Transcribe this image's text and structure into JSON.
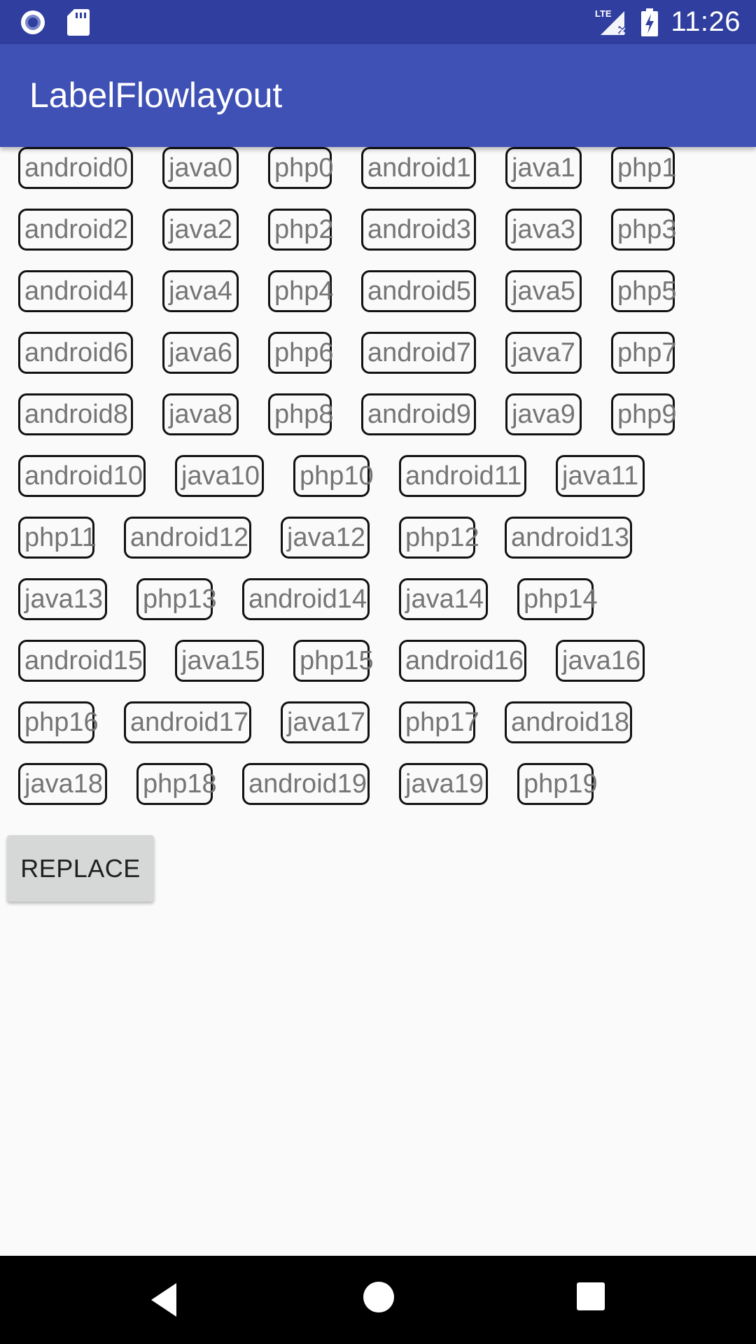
{
  "status_bar": {
    "time": "11:26",
    "network": "LTE",
    "left_icons": [
      "radio-record-icon",
      "sd-card-icon"
    ],
    "right_icons": [
      "lte-signal-no-data-icon",
      "battery-charging-icon"
    ]
  },
  "app_bar": {
    "title": "LabelFlowlayout"
  },
  "labels": [
    [
      "android0",
      "java0",
      "php0",
      "android1",
      "java1",
      "php1"
    ],
    [
      "android2",
      "java2",
      "php2",
      "android3",
      "java3",
      "php3"
    ],
    [
      "android4",
      "java4",
      "php4",
      "android5",
      "java5",
      "php5"
    ],
    [
      "android6",
      "java6",
      "php6",
      "android7",
      "java7",
      "php7"
    ],
    [
      "android8",
      "java8",
      "php8",
      "android9",
      "java9",
      "php9"
    ],
    [
      "android10",
      "java10",
      "php10",
      "android11",
      "java11"
    ],
    [
      "php11",
      "android12",
      "java12",
      "php12",
      "android13"
    ],
    [
      "java13",
      "php13",
      "android14",
      "java14",
      "php14"
    ],
    [
      "android15",
      "java15",
      "php15",
      "android16",
      "java16"
    ],
    [
      "php16",
      "android17",
      "java17",
      "php17",
      "android18"
    ],
    [
      "java18",
      "php18",
      "android19",
      "java19",
      "php19"
    ]
  ],
  "replace_button": {
    "label": "REPLACE"
  },
  "nav_bar": {
    "icons": [
      "back-icon",
      "home-icon",
      "recents-icon"
    ]
  },
  "colors": {
    "status_bar": "#303f9f",
    "app_bar": "#3f51b5",
    "background": "#fafafa",
    "tag_text": "#757575",
    "tag_border": "#111111",
    "button": "#d6d7d7"
  }
}
